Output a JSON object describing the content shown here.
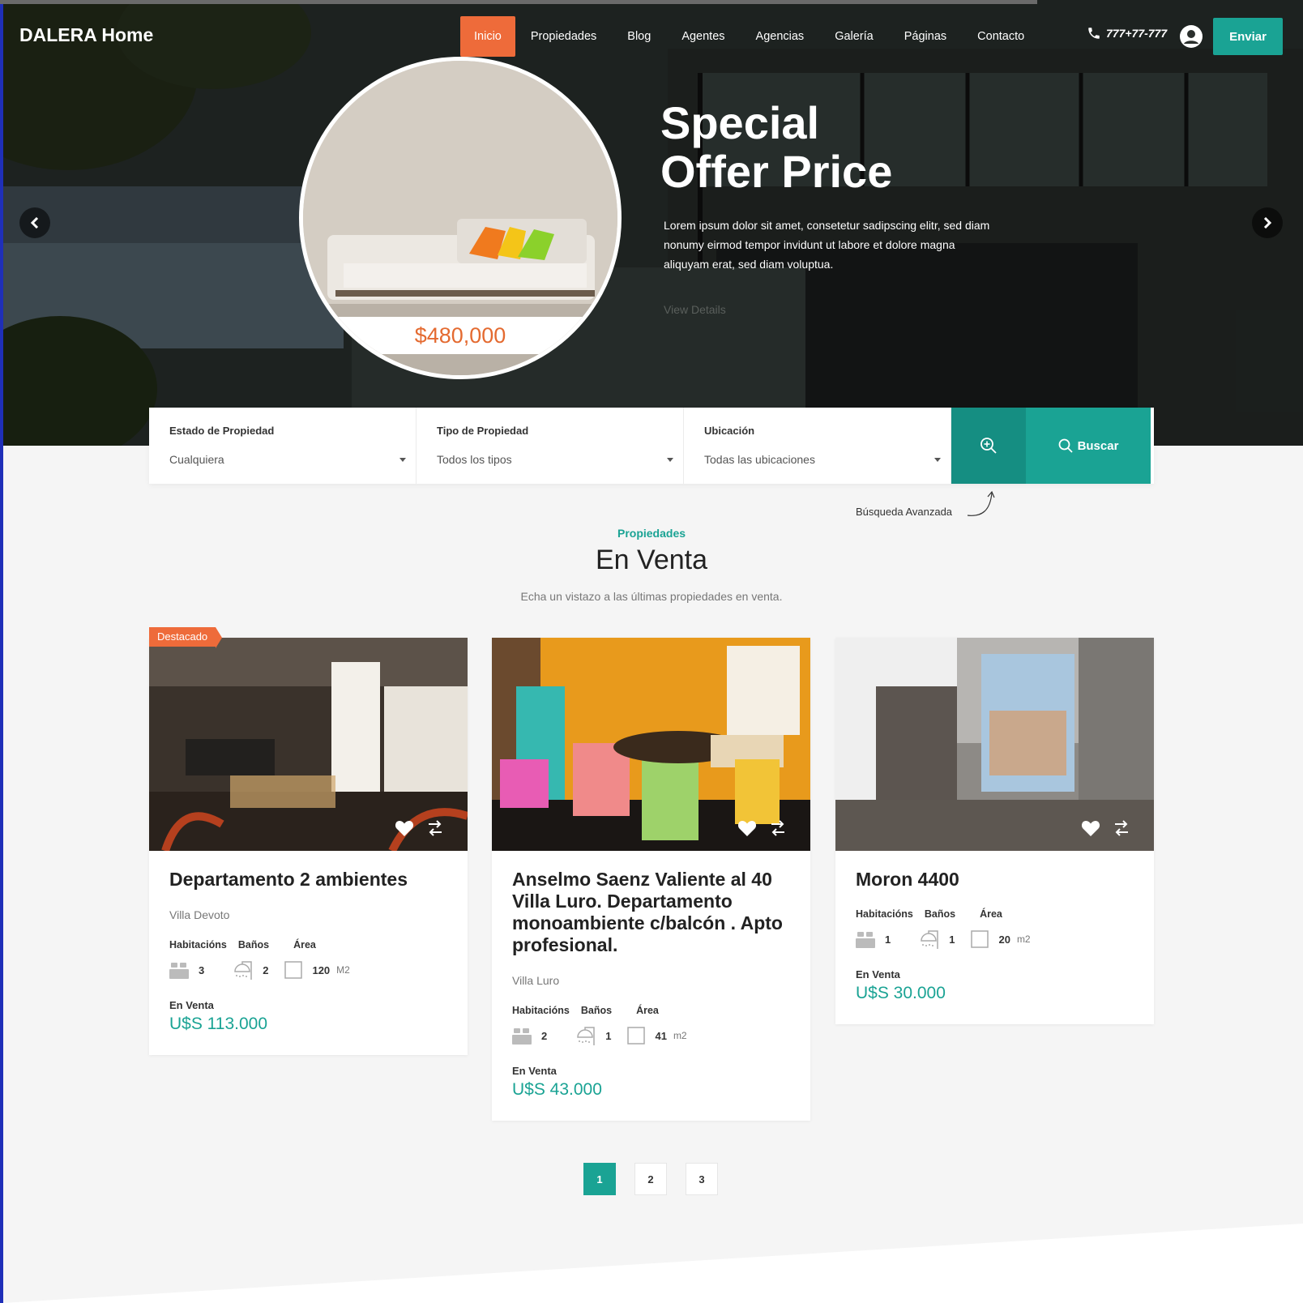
{
  "brand": "DALERA Home",
  "nav": {
    "items": [
      "Inicio",
      "Propiedades",
      "Blog",
      "Agentes",
      "Agencias",
      "Galería",
      "Páginas",
      "Contacto"
    ],
    "phone": "777+77-777",
    "send_label": "Enviar"
  },
  "hero": {
    "title_line1": "Special",
    "title_line2": "Offer Price",
    "text": "Lorem ipsum dolor sit amet, consetetur sadipscing elitr, sed diam nonumy eirmod tempor invidunt ut labore et dolore magna aliquyam erat, sed diam voluptua.",
    "link": "View Details",
    "price": "$480,000"
  },
  "search": {
    "fields": [
      {
        "label": "Estado de Propiedad",
        "value": "Cualquiera"
      },
      {
        "label": "Tipo de Propiedad",
        "value": "Todos los tipos"
      },
      {
        "label": "Ubicación",
        "value": "Todas las ubicaciones"
      }
    ],
    "button": "Buscar",
    "advanced": "Búsqueda Avanzada"
  },
  "section": {
    "subtitle": "Propiedades",
    "title": "En Venta",
    "description": "Echa un vistazo a las últimas propiedades en venta."
  },
  "feature_labels": {
    "rooms": "Habitacións",
    "baths": "Baños",
    "area": "Área"
  },
  "cards": [
    {
      "badge": "Destacado",
      "title": "Departamento 2 ambientes",
      "location": "Villa Devoto",
      "rooms": "3",
      "baths": "2",
      "area": "120",
      "unit": "M2",
      "status": "En Venta",
      "price": "U$S 113.000"
    },
    {
      "title": "Anselmo Saenz Valiente al 40 Villa Luro. Departamento monoambiente c/balcón . Apto profesional.",
      "location": "Villa Luro",
      "rooms": "2",
      "baths": "1",
      "area": "41",
      "unit": "m2",
      "status": "En Venta",
      "price": "U$S 43.000"
    },
    {
      "title": "Moron 4400",
      "location": "",
      "rooms": "1",
      "baths": "1",
      "area": "20",
      "unit": "m2",
      "status": "En Venta",
      "price": "U$S 30.000"
    }
  ],
  "pagination": [
    "1",
    "2",
    "3"
  ],
  "colors": {
    "accent": "#1aa394",
    "orange": "#ee6b3a"
  }
}
